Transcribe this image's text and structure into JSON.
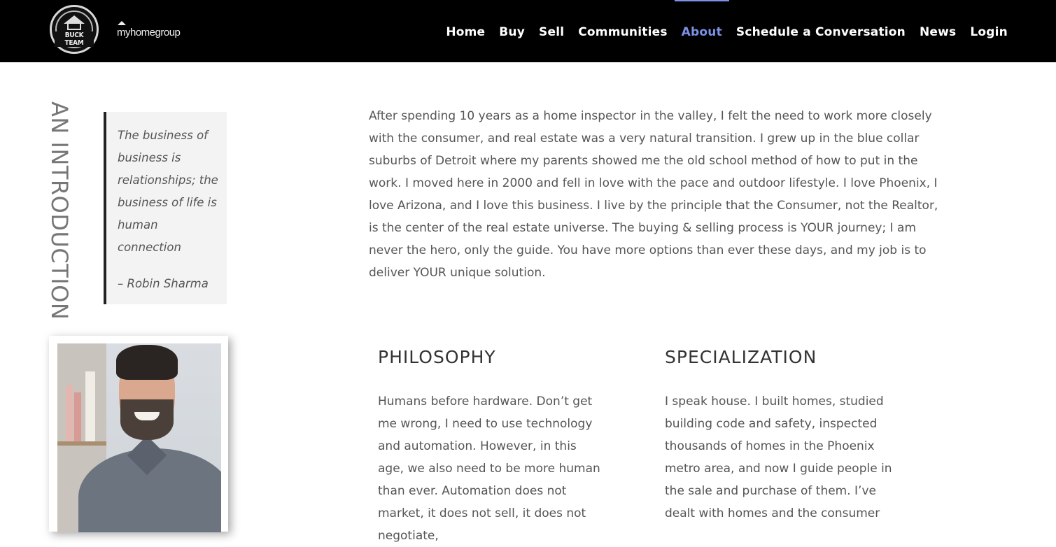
{
  "header": {
    "logo_text": "BUCK TEAM",
    "brand2": "myhomegroup",
    "nav": [
      "Home",
      "Buy",
      "Sell",
      "Communities",
      "About",
      "Schedule a Conversation",
      "News",
      "Login"
    ],
    "active": "About",
    "active_color": "#7b92e6"
  },
  "intro_title": "AN INTRODUCTION",
  "quote": {
    "text": "The business of business is relationships; the business of life is human connection",
    "author": "– Robin Sharma"
  },
  "intro_paragraph": "After spending 10 years as a home inspector in the valley, I felt the need to work more closely with the consumer, and real estate was a very natural transition. I grew up in the blue collar suburbs of Detroit where my parents showed me the old school method of how to put in the work. I moved here in 2000 and fell in love with the pace and outdoor lifestyle. I love Phoenix, I love Arizona, and I love this business. I live by the principle that the Consumer, not the Realtor, is the center of the real estate universe. The buying & selling process is YOUR journey; I am never the hero, only the guide. You have more options than ever these days, and my job is to deliver YOUR unique solution.",
  "philosophy": {
    "title": "PHILOSOPHY",
    "text": "Humans before hardware. Don’t get me wrong, I need to use technology and automation. However, in this age, we also need to be more human than ever. Automation does not market, it does not sell, it does not negotiate,"
  },
  "specialization": {
    "title": "SPECIALIZATION",
    "text": "I speak house. I built homes, studied building code and safety, inspected thousands of homes in the Phoenix metro area, and now I guide people in the sale and purchase of them. I’ve dealt with homes and the consumer"
  }
}
